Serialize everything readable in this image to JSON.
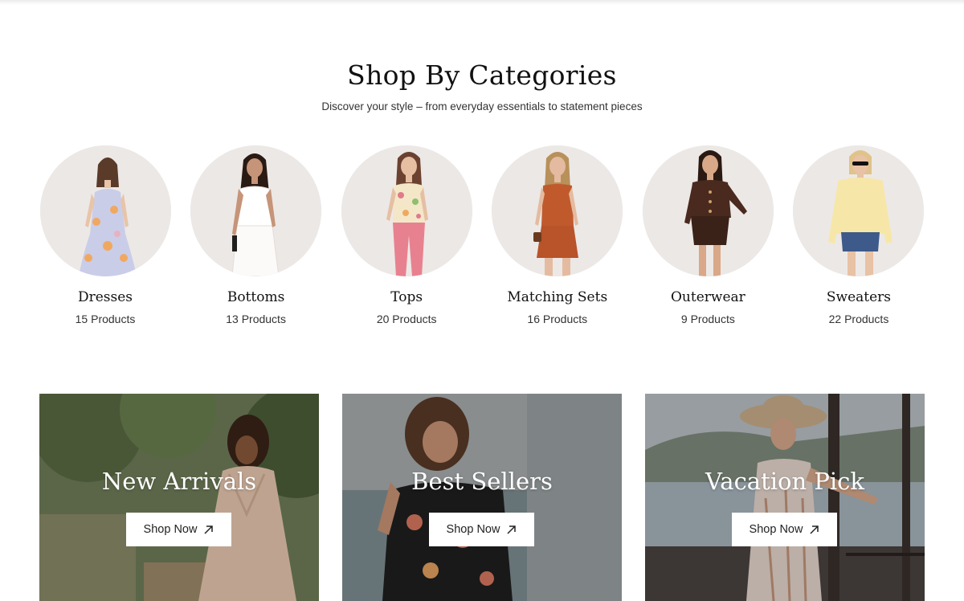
{
  "section": {
    "title": "Shop By Categories",
    "subtitle": "Discover your style – from everyday essentials to statement pieces"
  },
  "categories": [
    {
      "name": "Dresses",
      "count": "15 Products",
      "icon": "dress-model-image"
    },
    {
      "name": "Bottoms",
      "count": "13 Products",
      "icon": "bottoms-model-image"
    },
    {
      "name": "Tops",
      "count": "20 Products",
      "icon": "tops-model-image"
    },
    {
      "name": "Matching Sets",
      "count": "16 Products",
      "icon": "matching-sets-model-image"
    },
    {
      "name": "Outerwear",
      "count": "9 Products",
      "icon": "outerwear-model-image"
    },
    {
      "name": "Sweaters",
      "count": "22 Products",
      "icon": "sweaters-model-image"
    }
  ],
  "banners": [
    {
      "title": "New Arrivals",
      "button": "Shop Now",
      "icon": "arrow-up-right-icon"
    },
    {
      "title": "Best Sellers",
      "button": "Shop Now",
      "icon": "arrow-up-right-icon"
    },
    {
      "title": "Vacation Pick",
      "button": "Shop Now",
      "icon": "arrow-up-right-icon"
    }
  ],
  "colors": {
    "circle_bg": "#ece8e6",
    "text": "#111111",
    "button_bg": "#ffffff"
  }
}
